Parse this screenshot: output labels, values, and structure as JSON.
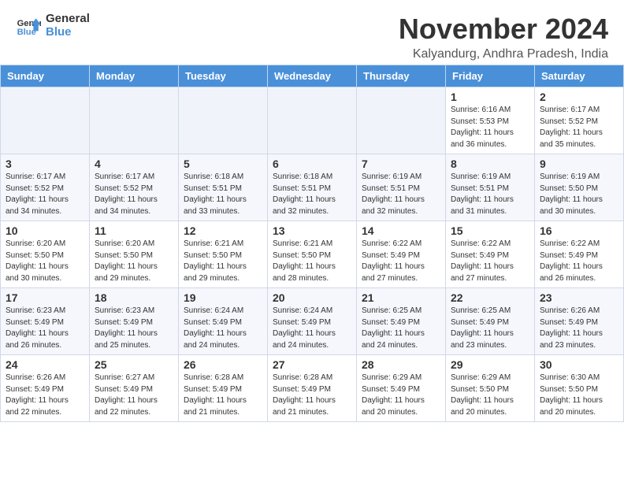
{
  "header": {
    "logo_line1": "General",
    "logo_line2": "Blue",
    "month_title": "November 2024",
    "location": "Kalyandurg, Andhra Pradesh, India"
  },
  "days_of_week": [
    "Sunday",
    "Monday",
    "Tuesday",
    "Wednesday",
    "Thursday",
    "Friday",
    "Saturday"
  ],
  "weeks": [
    [
      {
        "day": "",
        "info": "",
        "empty": true
      },
      {
        "day": "",
        "info": "",
        "empty": true
      },
      {
        "day": "",
        "info": "",
        "empty": true
      },
      {
        "day": "",
        "info": "",
        "empty": true
      },
      {
        "day": "",
        "info": "",
        "empty": true
      },
      {
        "day": "1",
        "info": "Sunrise: 6:16 AM\nSunset: 5:53 PM\nDaylight: 11 hours\nand 36 minutes.",
        "empty": false
      },
      {
        "day": "2",
        "info": "Sunrise: 6:17 AM\nSunset: 5:52 PM\nDaylight: 11 hours\nand 35 minutes.",
        "empty": false
      }
    ],
    [
      {
        "day": "3",
        "info": "Sunrise: 6:17 AM\nSunset: 5:52 PM\nDaylight: 11 hours\nand 34 minutes.",
        "empty": false
      },
      {
        "day": "4",
        "info": "Sunrise: 6:17 AM\nSunset: 5:52 PM\nDaylight: 11 hours\nand 34 minutes.",
        "empty": false
      },
      {
        "day": "5",
        "info": "Sunrise: 6:18 AM\nSunset: 5:51 PM\nDaylight: 11 hours\nand 33 minutes.",
        "empty": false
      },
      {
        "day": "6",
        "info": "Sunrise: 6:18 AM\nSunset: 5:51 PM\nDaylight: 11 hours\nand 32 minutes.",
        "empty": false
      },
      {
        "day": "7",
        "info": "Sunrise: 6:19 AM\nSunset: 5:51 PM\nDaylight: 11 hours\nand 32 minutes.",
        "empty": false
      },
      {
        "day": "8",
        "info": "Sunrise: 6:19 AM\nSunset: 5:51 PM\nDaylight: 11 hours\nand 31 minutes.",
        "empty": false
      },
      {
        "day": "9",
        "info": "Sunrise: 6:19 AM\nSunset: 5:50 PM\nDaylight: 11 hours\nand 30 minutes.",
        "empty": false
      }
    ],
    [
      {
        "day": "10",
        "info": "Sunrise: 6:20 AM\nSunset: 5:50 PM\nDaylight: 11 hours\nand 30 minutes.",
        "empty": false
      },
      {
        "day": "11",
        "info": "Sunrise: 6:20 AM\nSunset: 5:50 PM\nDaylight: 11 hours\nand 29 minutes.",
        "empty": false
      },
      {
        "day": "12",
        "info": "Sunrise: 6:21 AM\nSunset: 5:50 PM\nDaylight: 11 hours\nand 29 minutes.",
        "empty": false
      },
      {
        "day": "13",
        "info": "Sunrise: 6:21 AM\nSunset: 5:50 PM\nDaylight: 11 hours\nand 28 minutes.",
        "empty": false
      },
      {
        "day": "14",
        "info": "Sunrise: 6:22 AM\nSunset: 5:49 PM\nDaylight: 11 hours\nand 27 minutes.",
        "empty": false
      },
      {
        "day": "15",
        "info": "Sunrise: 6:22 AM\nSunset: 5:49 PM\nDaylight: 11 hours\nand 27 minutes.",
        "empty": false
      },
      {
        "day": "16",
        "info": "Sunrise: 6:22 AM\nSunset: 5:49 PM\nDaylight: 11 hours\nand 26 minutes.",
        "empty": false
      }
    ],
    [
      {
        "day": "17",
        "info": "Sunrise: 6:23 AM\nSunset: 5:49 PM\nDaylight: 11 hours\nand 26 minutes.",
        "empty": false
      },
      {
        "day": "18",
        "info": "Sunrise: 6:23 AM\nSunset: 5:49 PM\nDaylight: 11 hours\nand 25 minutes.",
        "empty": false
      },
      {
        "day": "19",
        "info": "Sunrise: 6:24 AM\nSunset: 5:49 PM\nDaylight: 11 hours\nand 24 minutes.",
        "empty": false
      },
      {
        "day": "20",
        "info": "Sunrise: 6:24 AM\nSunset: 5:49 PM\nDaylight: 11 hours\nand 24 minutes.",
        "empty": false
      },
      {
        "day": "21",
        "info": "Sunrise: 6:25 AM\nSunset: 5:49 PM\nDaylight: 11 hours\nand 24 minutes.",
        "empty": false
      },
      {
        "day": "22",
        "info": "Sunrise: 6:25 AM\nSunset: 5:49 PM\nDaylight: 11 hours\nand 23 minutes.",
        "empty": false
      },
      {
        "day": "23",
        "info": "Sunrise: 6:26 AM\nSunset: 5:49 PM\nDaylight: 11 hours\nand 23 minutes.",
        "empty": false
      }
    ],
    [
      {
        "day": "24",
        "info": "Sunrise: 6:26 AM\nSunset: 5:49 PM\nDaylight: 11 hours\nand 22 minutes.",
        "empty": false
      },
      {
        "day": "25",
        "info": "Sunrise: 6:27 AM\nSunset: 5:49 PM\nDaylight: 11 hours\nand 22 minutes.",
        "empty": false
      },
      {
        "day": "26",
        "info": "Sunrise: 6:28 AM\nSunset: 5:49 PM\nDaylight: 11 hours\nand 21 minutes.",
        "empty": false
      },
      {
        "day": "27",
        "info": "Sunrise: 6:28 AM\nSunset: 5:49 PM\nDaylight: 11 hours\nand 21 minutes.",
        "empty": false
      },
      {
        "day": "28",
        "info": "Sunrise: 6:29 AM\nSunset: 5:49 PM\nDaylight: 11 hours\nand 20 minutes.",
        "empty": false
      },
      {
        "day": "29",
        "info": "Sunrise: 6:29 AM\nSunset: 5:50 PM\nDaylight: 11 hours\nand 20 minutes.",
        "empty": false
      },
      {
        "day": "30",
        "info": "Sunrise: 6:30 AM\nSunset: 5:50 PM\nDaylight: 11 hours\nand 20 minutes.",
        "empty": false
      }
    ]
  ]
}
